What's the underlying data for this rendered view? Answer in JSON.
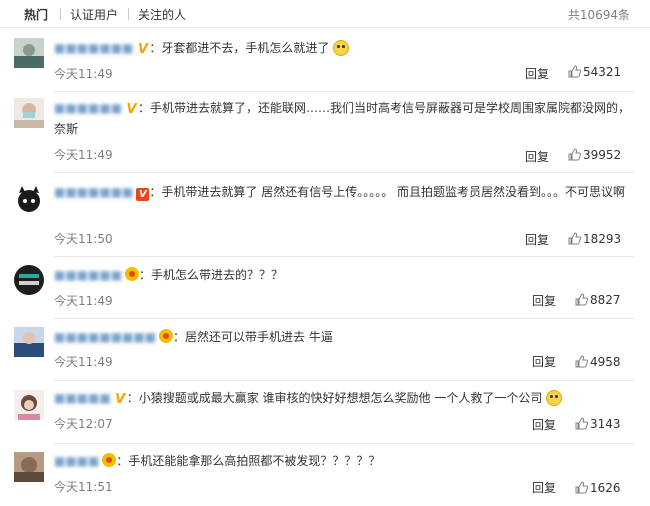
{
  "tabs": [
    {
      "label": "热门"
    },
    {
      "label": "认证用户"
    },
    {
      "label": "关注的人"
    }
  ],
  "total": "共10694条",
  "reply_label": "回复",
  "comments": [
    {
      "username": "■■■■■■■",
      "badge": "V-gold",
      "text": "：牙套都进不去，手机怎么就进了",
      "time": "今天11:49",
      "likes": "54321"
    },
    {
      "username": "■■■■■■",
      "badge": "V-gold",
      "text": "：手机带进去就算了，还能联网……我们当时高考信号屏蔽器可是学校周围家属院都没网的，奈斯",
      "time": "今天11:49",
      "likes": "39952"
    },
    {
      "username": "■■■■■■■",
      "badge": "V-red",
      "text": "：手机带进去就算了 居然还有信号上传。。。。。 而且拍题监考员居然没看到。。。不可思议啊",
      "time": "今天11:50",
      "likes": "18293"
    },
    {
      "username": "■■■■■■",
      "badge": "crown",
      "text": "：手机怎么带进去的？？？",
      "time": "今天11:49",
      "likes": "8827"
    },
    {
      "username": "■■■■■■■■■",
      "badge": "crown",
      "text": "：居然还可以带手机进去 牛逼",
      "time": "今天11:49",
      "likes": "4958"
    },
    {
      "username": "■■■■■",
      "badge": "V-gold",
      "text": "：小猿搜题或成最大赢家 谁审核的快好好想想怎么奖励他 一个人救了一个公司",
      "time": "今天12:07",
      "likes": "3143"
    },
    {
      "username": "■■■■",
      "badge": "crown",
      "text": "：手机还能能拿那么高拍照都不被发现？？？？？",
      "time": "今天11:51",
      "likes": "1626"
    }
  ]
}
